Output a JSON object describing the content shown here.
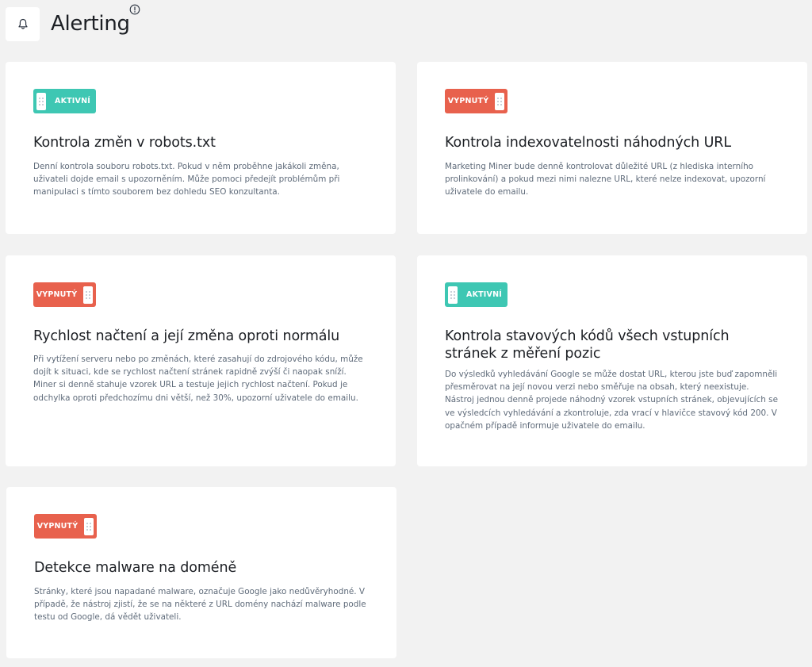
{
  "page": {
    "title": "Alerting",
    "bell_icon": "bell-icon",
    "info_icon": "info-icon"
  },
  "colors": {
    "active": "#3ec7b3",
    "inactive": "#e8614d",
    "background": "#f2f2f2"
  },
  "cards": [
    {
      "status": "AKTIVNÍ",
      "enabled": true,
      "title": "Kontrola změn v robots.txt",
      "description": "Denní kontrola souboru robots.txt. Pokud v něm proběhne jakákoli změna, uživateli dojde email s upozorněním. Může pomoci předejít problémům při manipulaci s tímto souborem bez dohledu SEO konzultanta."
    },
    {
      "status": "VYPNUTÝ",
      "enabled": false,
      "title": "Kontrola indexovatelnosti náhodných URL",
      "description": "Marketing Miner bude denně kontrolovat důležité URL (z hlediska interního prolinkování) a pokud mezi nimi nalezne URL, které nelze indexovat, upozorní uživatele do emailu."
    },
    {
      "status": "VYPNUTÝ",
      "enabled": false,
      "title": "Rychlost načtení a její změna oproti normálu",
      "description": "Při vytížení serveru nebo po změnách, které zasahují do zdrojového kódu, může dojít k situaci, kde se rychlost načtení stránek rapidně zvýší či naopak sníží. Miner si denně stahuje vzorek URL a testuje jejich rychlost načtení. Pokud je odchylka oproti předchozímu dni větší, než 30%, upozorní uživatele do emailu."
    },
    {
      "status": "AKTIVNÍ",
      "enabled": true,
      "title": "Kontrola stavových kódů všech vstupních stránek z měření pozic",
      "description": "Do výsledků vyhledávání Google se může dostat URL, kterou jste buď zapomněli přesměrovat na její novou verzi nebo směřuje na obsah, který neexistuje. Nástroj jednou denně projede náhodný vzorek vstupních stránek, objevujících se ve výsledcích vyhledávání a zkontroluje, zda vrací v hlavičce stavový kód 200. V opačném případě informuje uživatele do emailu."
    },
    {
      "status": "VYPNUTÝ",
      "enabled": false,
      "title": "Detekce malware na doméně",
      "description": "Stránky, které jsou napadané malware, označuje Google jako nedůvěryhodné. V případě, že nástroj zjistí, že se na některé z URL domény nachází malware podle testu od Google, dá vědět uživateli."
    }
  ]
}
